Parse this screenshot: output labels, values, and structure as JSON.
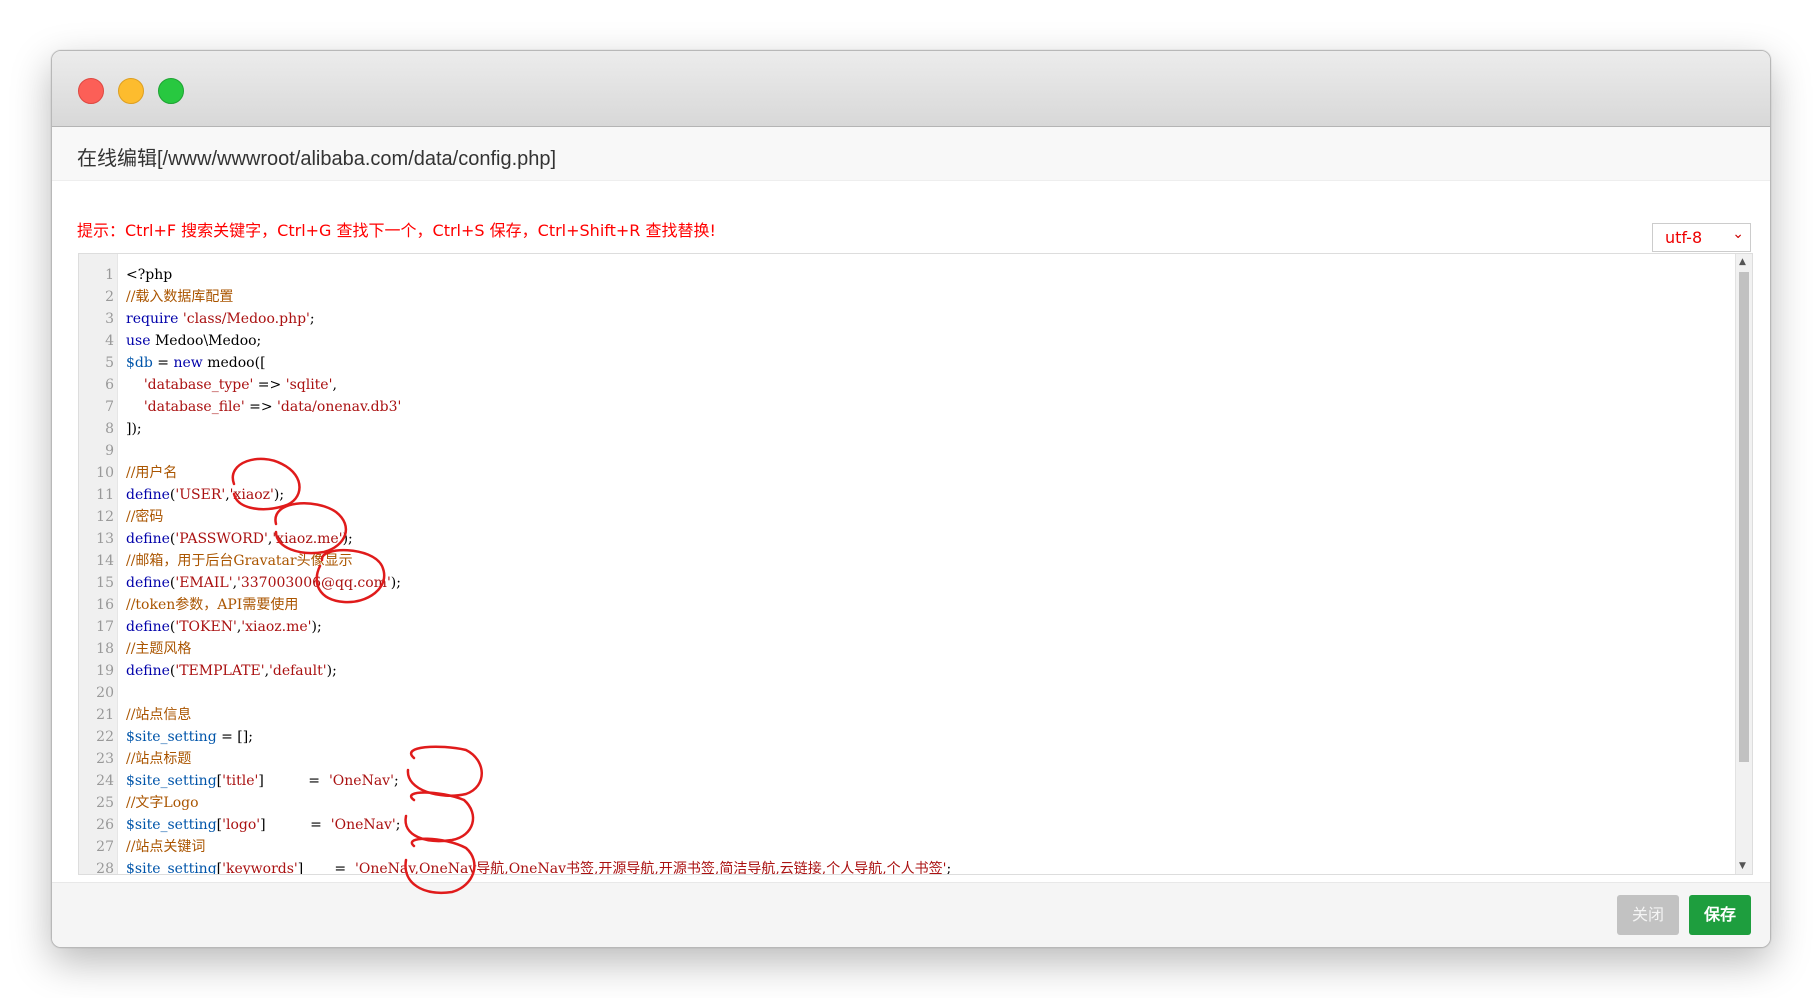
{
  "dialog": {
    "title": "在线编辑[/www/wwwroot/alibaba.com/data/config.php]",
    "hint": "提示：Ctrl+F 搜索关键字，Ctrl+G 查找下一个，Ctrl+S 保存，Ctrl+Shift+R 查找替换!",
    "encoding": "utf-8",
    "close_label": "关闭",
    "save_label": "保存"
  },
  "editor": {
    "lines": [
      {
        "n": "1",
        "tokens": [
          [
            "",
            "<?php"
          ]
        ]
      },
      {
        "n": "2",
        "tokens": [
          [
            "cm",
            "//载入数据库配置"
          ]
        ]
      },
      {
        "n": "3",
        "tokens": [
          [
            "kw",
            "require"
          ],
          [
            "",
            " "
          ],
          [
            "str",
            "'class/Medoo.php'"
          ],
          [
            "",
            ";"
          ]
        ]
      },
      {
        "n": "4",
        "tokens": [
          [
            "kw",
            "use"
          ],
          [
            "",
            " Medoo\\Medoo;"
          ]
        ]
      },
      {
        "n": "5",
        "tokens": [
          [
            "var",
            "$db"
          ],
          [
            "",
            " = "
          ],
          [
            "kw",
            "new"
          ],
          [
            "",
            " medoo(["
          ]
        ]
      },
      {
        "n": "6",
        "tokens": [
          [
            "",
            "    "
          ],
          [
            "str",
            "'database_type'"
          ],
          [
            "",
            " => "
          ],
          [
            "str",
            "'sqlite'"
          ],
          [
            "",
            ","
          ]
        ]
      },
      {
        "n": "7",
        "tokens": [
          [
            "",
            "    "
          ],
          [
            "str",
            "'database_file'"
          ],
          [
            "",
            " => "
          ],
          [
            "str",
            "'data/onenav.db3'"
          ]
        ]
      },
      {
        "n": "8",
        "tokens": [
          [
            "",
            "]);"
          ]
        ]
      },
      {
        "n": "9",
        "tokens": []
      },
      {
        "n": "10",
        "tokens": [
          [
            "cm",
            "//用户名"
          ]
        ]
      },
      {
        "n": "11",
        "tokens": [
          [
            "kw",
            "define"
          ],
          [
            "",
            "("
          ],
          [
            "str",
            "'USER'"
          ],
          [
            "",
            ","
          ],
          [
            "str",
            "'xiaoz'"
          ],
          [
            "",
            ");"
          ]
        ]
      },
      {
        "n": "12",
        "tokens": [
          [
            "cm",
            "//密码"
          ]
        ]
      },
      {
        "n": "13",
        "tokens": [
          [
            "kw",
            "define"
          ],
          [
            "",
            "("
          ],
          [
            "str",
            "'PASSWORD'"
          ],
          [
            "",
            ","
          ],
          [
            "str",
            "'xiaoz.me'"
          ],
          [
            "",
            ");"
          ]
        ]
      },
      {
        "n": "14",
        "tokens": [
          [
            "cm",
            "//邮箱，用于后台Gravatar头像显示"
          ]
        ]
      },
      {
        "n": "15",
        "tokens": [
          [
            "kw",
            "define"
          ],
          [
            "",
            "("
          ],
          [
            "str",
            "'EMAIL'"
          ],
          [
            "",
            ","
          ],
          [
            "str",
            "'337003006@qq.com'"
          ],
          [
            "",
            ");"
          ]
        ]
      },
      {
        "n": "16",
        "tokens": [
          [
            "cm",
            "//token参数，API需要使用"
          ]
        ]
      },
      {
        "n": "17",
        "tokens": [
          [
            "kw",
            "define"
          ],
          [
            "",
            "("
          ],
          [
            "str",
            "'TOKEN'"
          ],
          [
            "",
            ","
          ],
          [
            "str",
            "'xiaoz.me'"
          ],
          [
            "",
            ");"
          ]
        ]
      },
      {
        "n": "18",
        "tokens": [
          [
            "cm",
            "//主题风格"
          ]
        ]
      },
      {
        "n": "19",
        "tokens": [
          [
            "kw",
            "define"
          ],
          [
            "",
            "("
          ],
          [
            "str",
            "'TEMPLATE'"
          ],
          [
            "",
            ","
          ],
          [
            "str",
            "'default'"
          ],
          [
            "",
            ");"
          ]
        ]
      },
      {
        "n": "20",
        "tokens": []
      },
      {
        "n": "21",
        "tokens": [
          [
            "cm",
            "//站点信息"
          ]
        ]
      },
      {
        "n": "22",
        "tokens": [
          [
            "var",
            "$site_setting"
          ],
          [
            "",
            " = [];"
          ]
        ]
      },
      {
        "n": "23",
        "tokens": [
          [
            "cm",
            "//站点标题"
          ]
        ]
      },
      {
        "n": "24",
        "tokens": [
          [
            "var",
            "$site_setting"
          ],
          [
            "",
            "["
          ],
          [
            "str",
            "'title'"
          ],
          [
            "",
            "]          =  "
          ],
          [
            "str",
            "'OneNav'"
          ],
          [
            "",
            ";"
          ]
        ]
      },
      {
        "n": "25",
        "tokens": [
          [
            "cm",
            "//文字Logo"
          ]
        ]
      },
      {
        "n": "26",
        "tokens": [
          [
            "var",
            "$site_setting"
          ],
          [
            "",
            "["
          ],
          [
            "str",
            "'logo'"
          ],
          [
            "",
            "]          =  "
          ],
          [
            "str",
            "'OneNav'"
          ],
          [
            "",
            ";"
          ]
        ]
      },
      {
        "n": "27",
        "tokens": [
          [
            "cm",
            "//站点关键词"
          ]
        ]
      },
      {
        "n": "28",
        "tokens": [
          [
            "var",
            "$site_setting"
          ],
          [
            "",
            "["
          ],
          [
            "str",
            "'keywords'"
          ],
          [
            "",
            "]       =  "
          ],
          [
            "str",
            "'OneNav,OneNav导航,OneNav书签,开源导航,开源书签,简洁导航,云链接,个人导航,个人书签'"
          ],
          [
            "",
            ";"
          ]
        ]
      }
    ]
  }
}
